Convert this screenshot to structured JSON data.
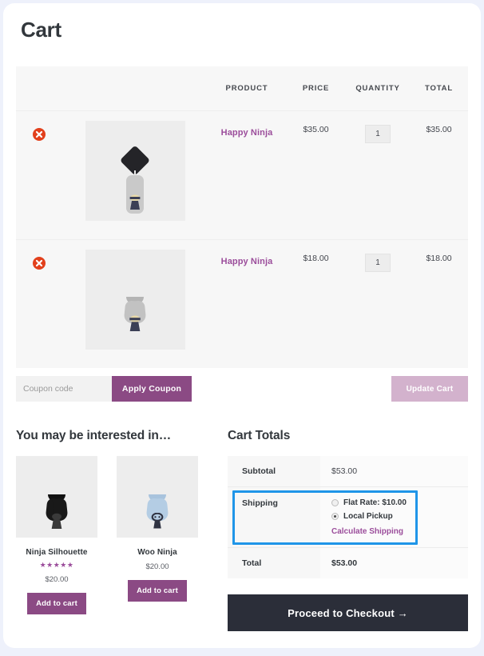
{
  "page": {
    "title": "Cart"
  },
  "cart_table": {
    "headers": [
      "",
      "",
      "PRODUCT",
      "PRICE",
      "QUANTITY",
      "TOTAL"
    ],
    "header_product": "PRODUCT",
    "header_price": "PRICE",
    "header_quantity": "QUANTITY",
    "header_total": "TOTAL",
    "remove_icon": "remove-circle-icon",
    "rows": [
      {
        "remove_label": "×",
        "thumb_alt": "grey-hoodie-image",
        "name": "Happy Ninja",
        "price": "$35.00",
        "quantity": "1",
        "total": "$35.00"
      },
      {
        "remove_label": "×",
        "thumb_alt": "grey-tshirt-image",
        "name": "Happy Ninja",
        "price": "$18.00",
        "quantity": "1",
        "total": "$18.00"
      }
    ]
  },
  "coupon": {
    "placeholder": "Coupon code",
    "value": "",
    "apply_label": "Apply Coupon",
    "update_label": "Update Cart"
  },
  "upsell": {
    "title": "You may be interested in…",
    "products": [
      {
        "thumb_alt": "black-tshirt-image",
        "name": "Ninja Silhouette",
        "rating": "★★★★★",
        "price": "$20.00",
        "button_label": "Add to cart"
      },
      {
        "thumb_alt": "light-blue-tshirt-image",
        "name": "Woo Ninja",
        "rating": "",
        "price": "$20.00",
        "button_label": "Add to cart"
      }
    ]
  },
  "cart_totals": {
    "title": "Cart Totals",
    "subtotal_label": "Subtotal",
    "subtotal_value": "$53.00",
    "shipping_label": "Shipping",
    "shipping_options": [
      {
        "label": "Flat Rate: $10.00",
        "selected": false
      },
      {
        "label": "Local Pickup",
        "selected": true
      }
    ],
    "calculate_shipping_label": "Calculate Shipping",
    "total_label": "Total",
    "total_value": "$53.00",
    "checkout_label": "Proceed to Checkout  →"
  },
  "colors": {
    "accent_purple": "#8b4a84",
    "link_purple": "#9b4d9b",
    "remove_red": "#e2401c",
    "highlight_blue": "#1f95e8",
    "checkout_dark": "#2b2e39",
    "page_bg": "#eef1fb",
    "table_bg": "#f7f7f7"
  }
}
